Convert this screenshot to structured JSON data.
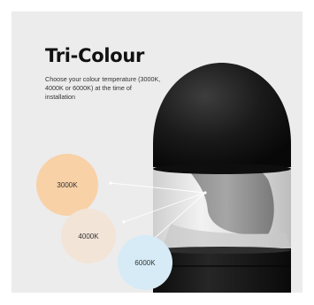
{
  "heading": {
    "title": "Tri-Colour",
    "description": "Choose your colour temperature (3000K, 4000K or 6000K) at the time of installation"
  },
  "swatches": [
    {
      "label": "3000K",
      "color": "#f8d1a7"
    },
    {
      "label": "4000K",
      "color": "#f3e4d8"
    },
    {
      "label": "6000K",
      "color": "#d6ebf6"
    }
  ],
  "product": {
    "image": "black-bollard-light",
    "body_color": "#141414",
    "diffuser_color": "#e6e6e6"
  }
}
